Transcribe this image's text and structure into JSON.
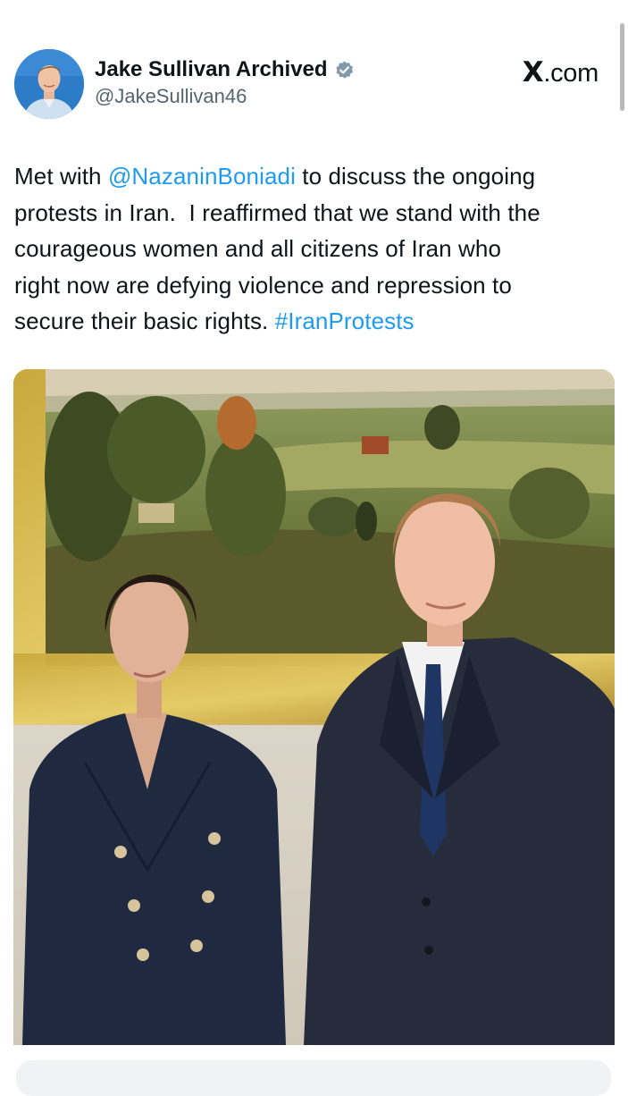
{
  "tweet": {
    "author": {
      "display_name": "Jake Sullivan Archived",
      "handle": "@JakeSullivan46",
      "verified": true,
      "avatar_icon": "profile-avatar"
    },
    "brand": "X.com",
    "text_parts": {
      "t1": "Met with ",
      "mention": "@NazaninBoniadi",
      "t2": " to discuss the ongoing",
      "t3": "protests in Iran.  I reaffirmed that we stand with the",
      "t4": "courageous women and all citizens of Iran who",
      "t5": "right now are defying violence and repression to",
      "t6": "secure their basic rights. ",
      "hashtag": "#IranProtests"
    },
    "media": {
      "type": "photo"
    }
  },
  "colors": {
    "link": "#1d9bf0",
    "text": "#0f1419",
    "secondary": "#536471",
    "verified_badge": "#829aab"
  }
}
